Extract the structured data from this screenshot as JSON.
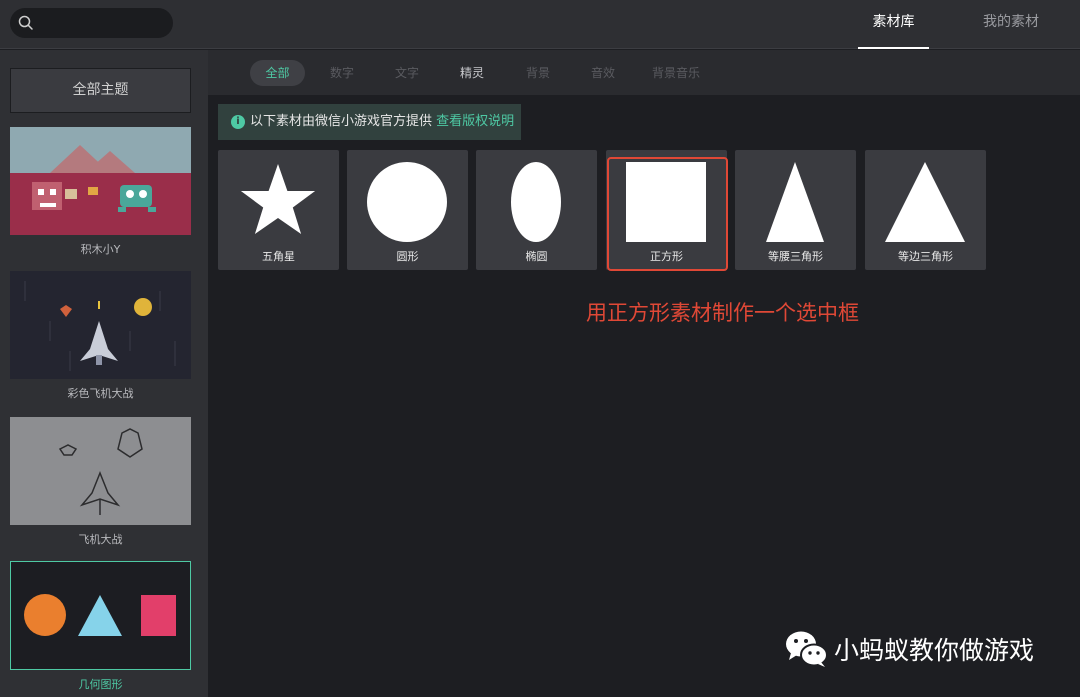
{
  "header": {
    "search": {
      "placeholder": ""
    },
    "tabs": [
      {
        "label": "素材库",
        "active": true
      },
      {
        "label": "我的素材",
        "active": false
      }
    ]
  },
  "sidebar": {
    "all_themes_label": "全部主题",
    "themes": [
      {
        "label": "积木小Y",
        "selected": false
      },
      {
        "label": "彩色飞机大战",
        "selected": false
      },
      {
        "label": "飞机大战",
        "selected": false
      },
      {
        "label": "几何图形",
        "selected": true
      }
    ]
  },
  "categories": [
    {
      "label": "全部",
      "state": "active"
    },
    {
      "label": "数字",
      "state": "disabled"
    },
    {
      "label": "文字",
      "state": "disabled"
    },
    {
      "label": "精灵",
      "state": "normal"
    },
    {
      "label": "背景",
      "state": "disabled"
    },
    {
      "label": "音效",
      "state": "disabled"
    },
    {
      "label": "背景音乐",
      "state": "disabled"
    }
  ],
  "notice": {
    "icon": "info-icon",
    "text": "以下素材由微信小游戏官方提供",
    "link": "查看版权说明"
  },
  "assets": [
    {
      "label": "五角星",
      "shape": "star"
    },
    {
      "label": "圆形",
      "shape": "circle"
    },
    {
      "label": "椭圆",
      "shape": "ellipse"
    },
    {
      "label": "正方形",
      "shape": "square",
      "highlighted": true
    },
    {
      "label": "等腰三角形",
      "shape": "isosceles-triangle"
    },
    {
      "label": "等边三角形",
      "shape": "equilateral-triangle"
    }
  ],
  "annotation": "用正方形素材制作一个选中框",
  "watermark": {
    "icon": "wechat-icon",
    "text": "小蚂蚁教你做游戏"
  },
  "colors": {
    "accent": "#4ec9a4",
    "annotation": "#e04836",
    "geometry_orange": "#ea7f2e",
    "geometry_blue": "#86d3ea",
    "geometry_pink": "#e23f6a"
  }
}
